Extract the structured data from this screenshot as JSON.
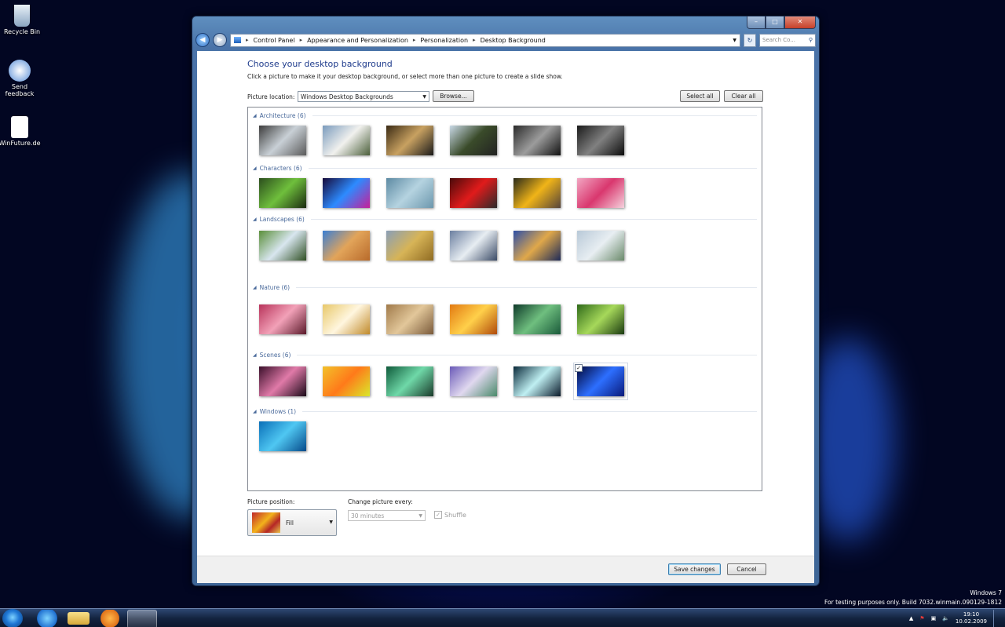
{
  "desktop": {
    "icons": [
      {
        "name": "recycle-bin",
        "label": "Recycle Bin"
      },
      {
        "name": "send-feedback",
        "label": "Send feedback"
      },
      {
        "name": "winfuture",
        "label": "WinFuture.de"
      }
    ],
    "watermark": {
      "line1": "Windows 7",
      "line2": "For testing purposes only. Build 7032.winmain.090129-1812"
    }
  },
  "window": {
    "caption_buttons": {
      "minimize": "–",
      "maximize": "□",
      "close": "✕"
    },
    "address": {
      "crumbs": [
        "Control Panel",
        "Appearance and Personalization",
        "Personalization",
        "Desktop Background"
      ],
      "search_placeholder": "Search Co..."
    },
    "heading": "Choose your desktop background",
    "subheading": "Click a picture to make it your desktop background, or select more than one picture to create a slide show.",
    "picture_location": {
      "label": "Picture location:",
      "value": "Windows Desktop Backgrounds",
      "browse": "Browse..."
    },
    "select_all": "Select all",
    "clear_all": "Clear all",
    "groups": [
      {
        "title": "Architecture (6)",
        "colors": [
          [
            "#3c3c3c",
            "#c9d0d6",
            "#5a5a5a"
          ],
          [
            "#7a9bbd",
            "#f1f1ee",
            "#4b5f3a"
          ],
          [
            "#3a2a14",
            "#c8a161",
            "#1a1a1a"
          ],
          [
            "#c9d9e6",
            "#3a4b2a",
            "#222"
          ],
          [
            "#2a2a2a",
            "#9c9c9c",
            "#111"
          ],
          [
            "#1a1a1a",
            "#808080",
            "#0c0c0c"
          ]
        ]
      },
      {
        "title": "Characters (6)",
        "colors": [
          [
            "#2b4d1d",
            "#6fbf3c",
            "#1a2a10"
          ],
          [
            "#170a3a",
            "#2d8bff",
            "#c71f9a"
          ],
          [
            "#5d8aa3",
            "#b5d3e0",
            "#6c97ad"
          ],
          [
            "#4a0a0a",
            "#e01b1b",
            "#2a2a2a"
          ],
          [
            "#2a2a1a",
            "#f0b418",
            "#55443a"
          ],
          [
            "#f2a7c3",
            "#d9376e",
            "#f5d2dd"
          ]
        ]
      },
      {
        "title": "Landscapes (6)",
        "colors": [
          [
            "#5a8f3a",
            "#d8e6ef",
            "#2f4f23"
          ],
          [
            "#3b7fd4",
            "#e2a45a",
            "#b86a2a"
          ],
          [
            "#8a9fb8",
            "#d7b457",
            "#8f6b22"
          ],
          [
            "#6b7fa0",
            "#e7edf2",
            "#3a4a66"
          ],
          [
            "#2d4fa8",
            "#e0a84a",
            "#1d2a58"
          ],
          [
            "#b8c9d8",
            "#e8eef2",
            "#6a8a6a"
          ]
        ]
      },
      {
        "title": "Nature (6)",
        "colors": [
          [
            "#b8335a",
            "#f2a1b8",
            "#5a1a2a"
          ],
          [
            "#e8c86a",
            "#fff6df",
            "#c08a2a"
          ],
          [
            "#a07a4a",
            "#e2c79a",
            "#7a5a3a"
          ],
          [
            "#e27a12",
            "#ffd04a",
            "#b04a0a"
          ],
          [
            "#0f3a2a",
            "#6fbf7f",
            "#1a5a3a"
          ],
          [
            "#2f6a1a",
            "#a6d85a",
            "#1a3a10"
          ]
        ]
      },
      {
        "title": "Scenes (6)",
        "colors": [
          [
            "#3a0f2a",
            "#e07aa8",
            "#1a0a18"
          ],
          [
            "#f2c12a",
            "#ff7a1a",
            "#d9e82a"
          ],
          [
            "#0f5a3a",
            "#6fd8a8",
            "#1a3a2a"
          ],
          [
            "#6a5ab8",
            "#e0d8ef",
            "#4a8a6a"
          ],
          [
            "#0a2a3a",
            "#bfeff2",
            "#0a1a2a"
          ],
          [
            "#02083a",
            "#2d6fff",
            "#0a1a7a"
          ]
        ]
      },
      {
        "title": "Windows (1)",
        "colors": [
          [
            "#0a6fb8",
            "#4fc7f2",
            "#064a8a"
          ]
        ]
      }
    ],
    "picture_position": {
      "label": "Picture position:",
      "value": "Fill"
    },
    "change_picture": {
      "label": "Change picture every:",
      "value": "30 minutes",
      "shuffle": "Shuffle"
    },
    "save": "Save changes",
    "cancel": "Cancel"
  },
  "taskbar": {
    "time": "19:10",
    "date": "10.02.2009"
  }
}
